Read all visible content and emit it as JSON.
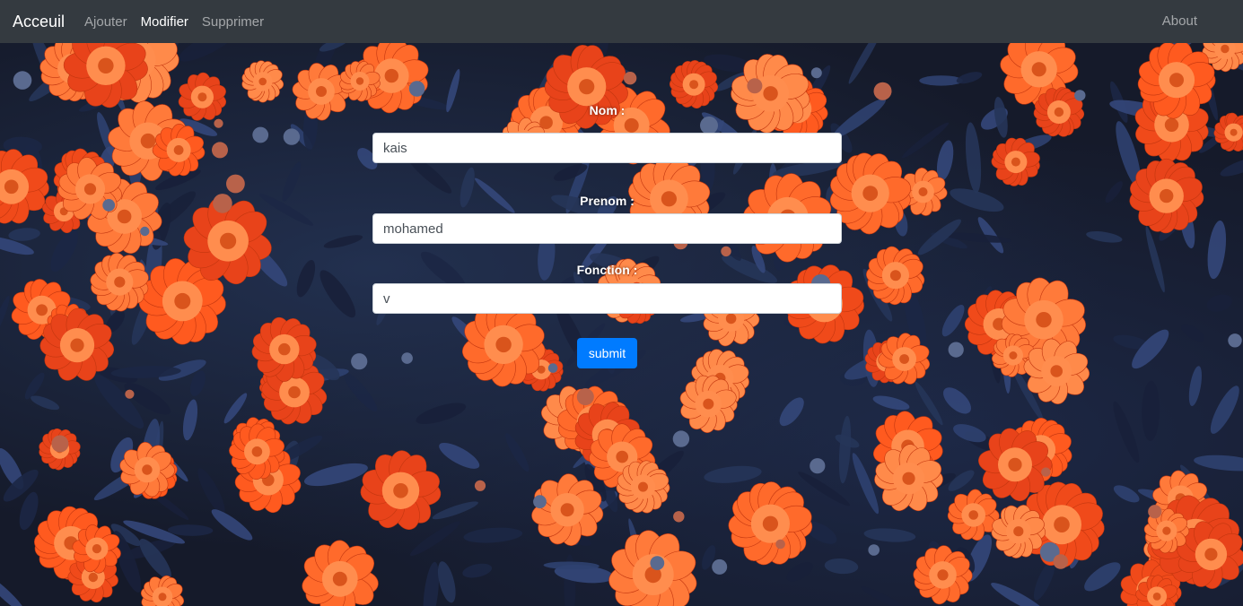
{
  "navbar": {
    "brand": "Acceuil",
    "links": [
      "Ajouter",
      "Modifier",
      "Supprimer"
    ],
    "active_link": "Modifier",
    "about": "About"
  },
  "form": {
    "nom_label": "Nom :",
    "nom_value": "kais",
    "prenom_label": "Prenom :",
    "prenom_value": "mohamed",
    "fonction_label": "Fonction :",
    "fonction_value": "v",
    "submit_label": "submit"
  },
  "colors": {
    "navbar_bg": "#343a40",
    "submit_bg": "#007bff",
    "flower_orange": "#ff5a1f",
    "leaf_navy": "#1c2745"
  },
  "background": {
    "image_subject": "field of orange marigold flowers with dark blue foliage"
  }
}
